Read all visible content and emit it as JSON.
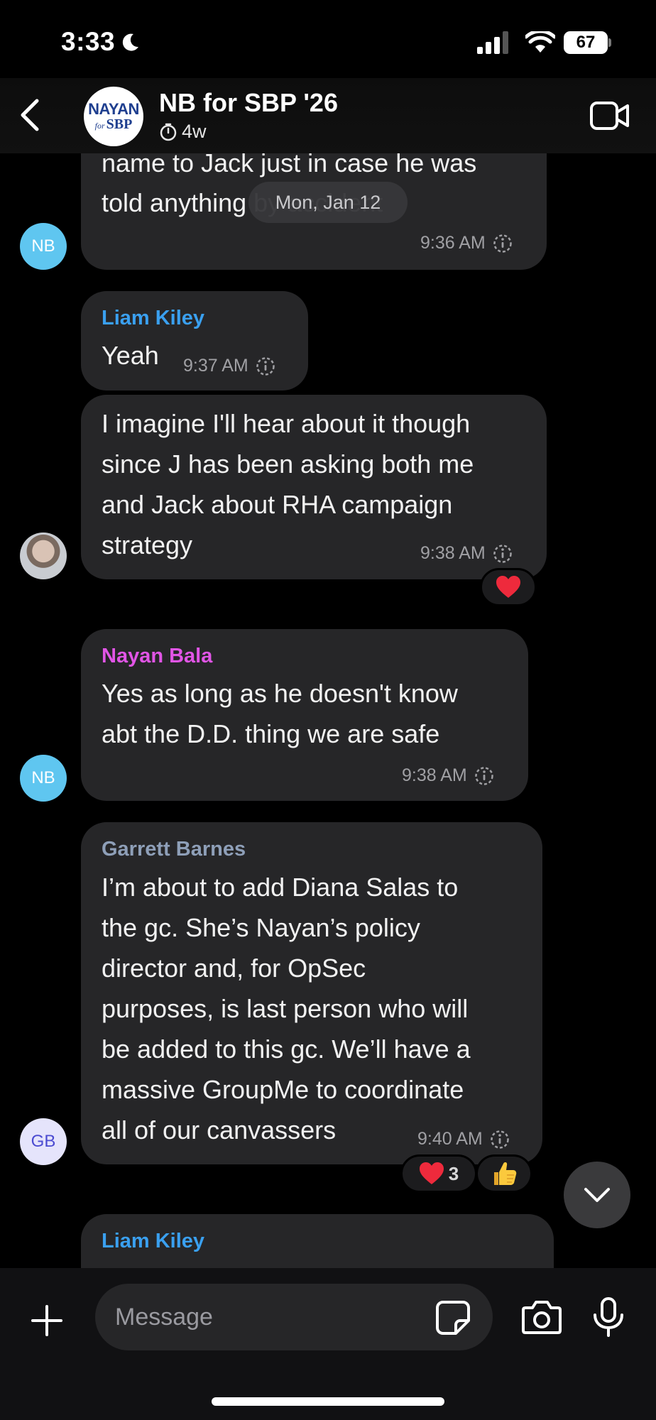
{
  "status_bar": {
    "time": "3:33",
    "battery": "67"
  },
  "header": {
    "title": "NB for SBP '26",
    "subtitle": "4w",
    "logo_top": "NAYAN",
    "logo_for": "for",
    "logo_bottom": "SBP"
  },
  "date_separator": "Mon, Jan 12",
  "messages": [
    {
      "lines": [
        "name to Jack just in case he was",
        "told anything by accident"
      ],
      "time": "9:36 AM",
      "avatar": "NB"
    },
    {
      "sender": "Liam Kiley",
      "sender_color": "#3aa0f0",
      "lines": [
        "Yeah"
      ],
      "time": "9:37 AM"
    },
    {
      "lines": [
        "I imagine I'll hear about it though",
        "since J has been asking both me",
        "and Jack about RHA campaign",
        "strategy"
      ],
      "time": "9:38 AM",
      "reaction": "heart"
    },
    {
      "sender": "Nayan Bala",
      "sender_color": "#e155e6",
      "lines": [
        "Yes as long as he doesn't know",
        "abt the D.D. thing we are safe"
      ],
      "time": "9:38 AM",
      "avatar": "NB"
    },
    {
      "sender": "Garrett Barnes",
      "sender_color": "#8e9fb8",
      "lines": [
        "I’m about to add Diana Salas to",
        "the gc. She’s Nayan’s policy",
        "director and, for OpSec",
        "purposes, is last person who will",
        "be added to this gc. We’ll have a",
        "massive GroupMe to coordinate",
        "all of our canvassers"
      ],
      "time": "9:40 AM",
      "avatar": "GB",
      "reaction_heart_count": "3",
      "reaction_second": "thumbs-up"
    },
    {
      "sender": "Liam Kiley",
      "sender_color": "#3aa0f0"
    }
  ],
  "composer": {
    "placeholder": "Message"
  },
  "icons": {
    "back": "chevron-left-icon",
    "timer": "timer-icon",
    "video": "video-call-icon",
    "seen": "dotted-circle-info-icon",
    "scroll": "chevron-down-icon",
    "plus": "plus-icon",
    "sticker": "sticker-icon",
    "camera": "camera-icon",
    "mic": "microphone-icon"
  }
}
